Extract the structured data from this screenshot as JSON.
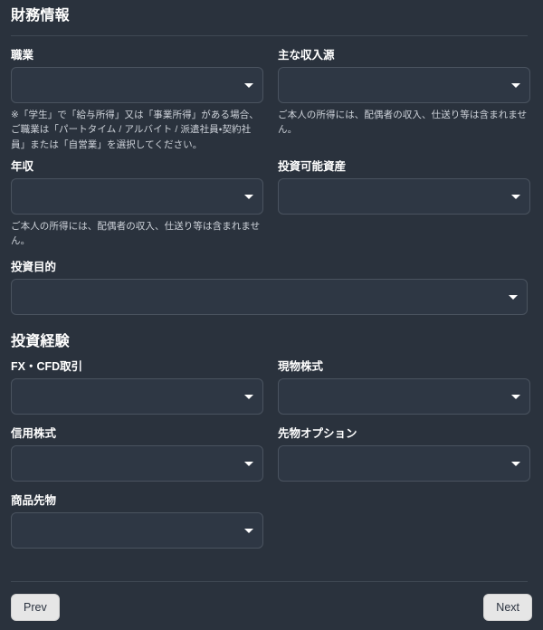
{
  "colors": {
    "page_background": "#2a323d",
    "field_background": "#2e3744",
    "field_border": "#4a535f",
    "divider": "#3f4853",
    "label_text": "#ffffff",
    "note_text": "#ced3da",
    "button_background": "#e6e6e6",
    "button_text": "#2b3340"
  },
  "sections": [
    {
      "id": "financial-information",
      "heading": "財務情報",
      "has_rule": true,
      "fields": [
        {
          "id": "occupation",
          "label": "職業",
          "value": "",
          "placeholder": "",
          "width": "half",
          "caret_icon": "chevron-down-icon",
          "note": "※「学生」で「給与所得」又は「事業所得」がある場合、ご職業は「パートタイム / アルバイト / 派遣社員・契約社員」または「自営業」を選択してください。"
        },
        {
          "id": "main-income-source",
          "label": "主な収入源",
          "value": "",
          "placeholder": "",
          "width": "half",
          "caret_icon": "chevron-down-icon",
          "note": "ご本人の所得には、配偶者の収入、仕送り等は含まれません。"
        },
        {
          "id": "annual-income",
          "label": "年収",
          "value": "",
          "placeholder": "",
          "width": "half",
          "caret_icon": "chevron-down-icon",
          "note": "ご本人の所得には、配偶者の収入、仕送り等は含まれません。"
        },
        {
          "id": "investable-assets",
          "label": "投資可能資産",
          "value": "",
          "placeholder": "",
          "width": "half",
          "caret_icon": "chevron-down-icon",
          "note": ""
        },
        {
          "id": "investment-purpose",
          "label": "投資目的",
          "value": "",
          "placeholder": "",
          "width": "full",
          "caret_icon": "chevron-down-icon",
          "note": ""
        }
      ]
    },
    {
      "id": "investment-experience",
      "heading": "投資経験",
      "has_rule": false,
      "fields": [
        {
          "id": "fx-cfd-trading",
          "label": "FX・CFD取引",
          "value": "",
          "placeholder": "",
          "width": "half",
          "caret_icon": "chevron-down-icon",
          "note": ""
        },
        {
          "id": "cash-equities",
          "label": "現物株式",
          "value": "",
          "placeholder": "",
          "width": "half",
          "caret_icon": "chevron-down-icon",
          "note": ""
        },
        {
          "id": "margin-equities",
          "label": "信用株式",
          "value": "",
          "placeholder": "",
          "width": "half",
          "caret_icon": "chevron-down-icon",
          "note": ""
        },
        {
          "id": "futures-options",
          "label": "先物オプション",
          "value": "",
          "placeholder": "",
          "width": "half",
          "caret_icon": "chevron-down-icon",
          "note": ""
        },
        {
          "id": "commodity-futures",
          "label": "商品先物",
          "value": "",
          "placeholder": "",
          "width": "half",
          "caret_icon": "chevron-down-icon",
          "note": ""
        }
      ]
    }
  ],
  "footer": {
    "prev_label": "Prev",
    "next_label": "Next"
  }
}
